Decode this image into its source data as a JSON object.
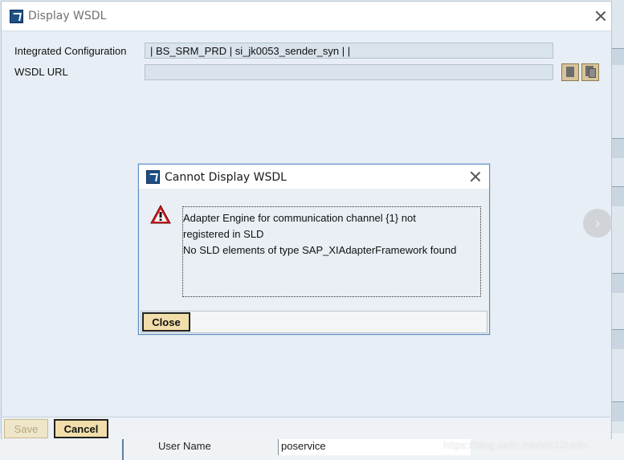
{
  "window": {
    "title": "Display WSDL",
    "fields": [
      {
        "label": "Integrated Configuration",
        "value": "| BS_SRM_PRD | si_jk0053_sender_syn |  |"
      },
      {
        "label": "WSDL URL",
        "value": ""
      }
    ],
    "buttons": {
      "save": "Save",
      "cancel": "Cancel"
    }
  },
  "dialog": {
    "title": "Cannot Display WSDL",
    "message_lines": [
      "Adapter Engine for communication channel {1} not",
      "registered in SLD",
      "No SLD elements of type SAP_XIAdapterFramework found"
    ],
    "close_label": "Close"
  },
  "background": {
    "user_name_label": "User Name",
    "user_name_value": "poservice",
    "watermark": "https://blog.csdn.net/ol512csdn"
  },
  "icons": {
    "nav_arrow": "›"
  },
  "colors": {
    "accent_border": "#5a8fc8",
    "button_bg": "#f2deaa",
    "field_bg": "#d9e3ec"
  }
}
